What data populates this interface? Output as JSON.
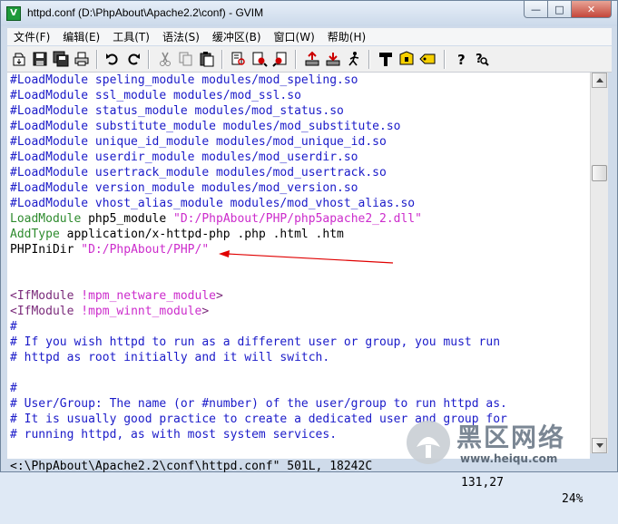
{
  "window": {
    "title": "httpd.conf (D:\\PhpAbout\\Apache2.2\\conf) - GVIM",
    "app_icon_letter": "V",
    "controls": {
      "minimize": "—",
      "maximize": "□",
      "close": "✕"
    }
  },
  "menu": [
    "文件(F)",
    "编辑(E)",
    "工具(T)",
    "语法(S)",
    "缓冲区(B)",
    "窗口(W)",
    "帮助(H)"
  ],
  "toolbar": [
    "open-icon",
    "save-icon",
    "save-all-icon",
    "print-icon",
    "undo-icon",
    "redo-icon",
    "cut-icon",
    "copy-icon",
    "paste-icon",
    "find-replace-icon",
    "find-next-icon",
    "find-prev-icon",
    "load-session-icon",
    "save-session-icon",
    "run-script-icon",
    "make-icon",
    "run-ctags-icon",
    "tag-jump-icon",
    "help-icon",
    "find-help-icon"
  ],
  "lines": [
    {
      "parts": [
        {
          "t": "#LoadModule speling_module modules/mod_speling.so",
          "c": "cmt"
        }
      ]
    },
    {
      "parts": [
        {
          "t": "#LoadModule ssl_module modules/mod_ssl.so",
          "c": "cmt"
        }
      ]
    },
    {
      "parts": [
        {
          "t": "#LoadModule status_module modules/mod_status.so",
          "c": "cmt"
        }
      ]
    },
    {
      "parts": [
        {
          "t": "#LoadModule substitute_module modules/mod_substitute.so",
          "c": "cmt"
        }
      ]
    },
    {
      "parts": [
        {
          "t": "#LoadModule unique_id_module modules/mod_unique_id.so",
          "c": "cmt"
        }
      ]
    },
    {
      "parts": [
        {
          "t": "#LoadModule userdir_module modules/mod_userdir.so",
          "c": "cmt"
        }
      ]
    },
    {
      "parts": [
        {
          "t": "#LoadModule usertrack_module modules/mod_usertrack.so",
          "c": "cmt"
        }
      ]
    },
    {
      "parts": [
        {
          "t": "#LoadModule version_module modules/mod_version.so",
          "c": "cmt"
        }
      ]
    },
    {
      "parts": [
        {
          "t": "#LoadModule vhost_alias_module modules/mod_vhost_alias.so",
          "c": "cmt"
        }
      ]
    },
    {
      "parts": [
        {
          "t": "LoadModule",
          "c": "kw-green"
        },
        {
          "t": " php5_module ",
          "c": "plain"
        },
        {
          "t": "\"D:/PhpAbout/PHP/php5apache2_2.dll\"",
          "c": "str"
        }
      ]
    },
    {
      "parts": [
        {
          "t": "AddType",
          "c": "kw-green"
        },
        {
          "t": " application/x-httpd-php .php .html .htm",
          "c": "plain"
        }
      ]
    },
    {
      "parts": [
        {
          "t": "PHPIniDir ",
          "c": "plain"
        },
        {
          "t": "\"D:/PhpAbout/PHP/\"",
          "c": "str"
        }
      ]
    },
    {
      "parts": []
    },
    {
      "parts": []
    },
    {
      "parts": [
        {
          "t": "<IfModule ",
          "c": "kw-purple"
        },
        {
          "t": "!mpm_netware_module",
          "c": "str"
        },
        {
          "t": ">",
          "c": "kw-purple"
        }
      ]
    },
    {
      "parts": [
        {
          "t": "<IfModule ",
          "c": "kw-purple"
        },
        {
          "t": "!mpm_winnt_module",
          "c": "str"
        },
        {
          "t": ">",
          "c": "kw-purple"
        }
      ]
    },
    {
      "parts": [
        {
          "t": "#",
          "c": "cmt"
        }
      ]
    },
    {
      "parts": [
        {
          "t": "# If you wish httpd to run as a different user or group, you must run",
          "c": "cmt"
        }
      ]
    },
    {
      "parts": [
        {
          "t": "# httpd as root initially and it will switch.",
          "c": "cmt"
        }
      ]
    },
    {
      "parts": []
    },
    {
      "parts": [
        {
          "t": "#",
          "c": "cmt"
        }
      ]
    },
    {
      "parts": [
        {
          "t": "# User/Group: The name (or #number) of the user/group to run httpd as.",
          "c": "cmt"
        }
      ]
    },
    {
      "parts": [
        {
          "t": "# It is usually good practice to create a dedicated user and group for",
          "c": "cmt"
        }
      ]
    },
    {
      "parts": [
        {
          "t": "# running httpd, as with most system services.",
          "c": "cmt"
        }
      ]
    }
  ],
  "status": {
    "file": "<:\\PhpAbout\\Apache2.2\\conf\\httpd.conf\" 501L, 18242C",
    "position": "131,27",
    "percent": "24%"
  },
  "watermark": {
    "text": "黑区网络",
    "sub": "www.heiqu.com"
  }
}
